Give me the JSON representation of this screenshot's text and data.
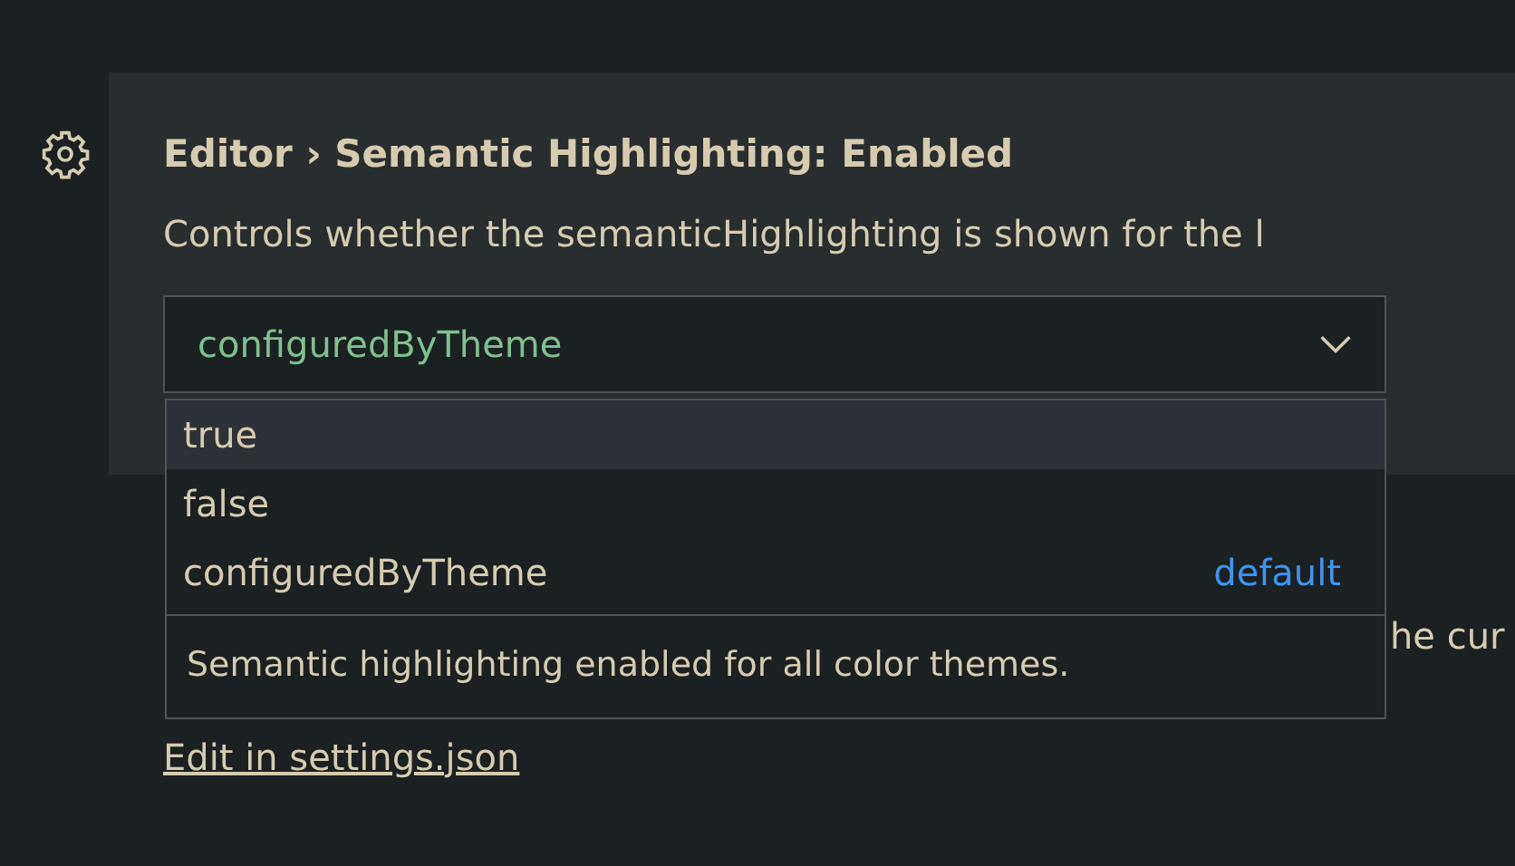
{
  "setting": {
    "title": "Editor › Semantic Highlighting: Enabled",
    "description": "Controls whether the semanticHighlighting is shown for the l",
    "value": "configuredByTheme"
  },
  "dropdown": {
    "options": [
      {
        "label": "true",
        "selected": true
      },
      {
        "label": "false",
        "selected": false
      },
      {
        "label": "configuredByTheme",
        "selected": false,
        "badge": "default"
      }
    ],
    "option_description": "Semantic highlighting enabled for all color themes."
  },
  "next_setting": {
    "description_fragment": "he cur",
    "link": "Edit in settings.json"
  }
}
